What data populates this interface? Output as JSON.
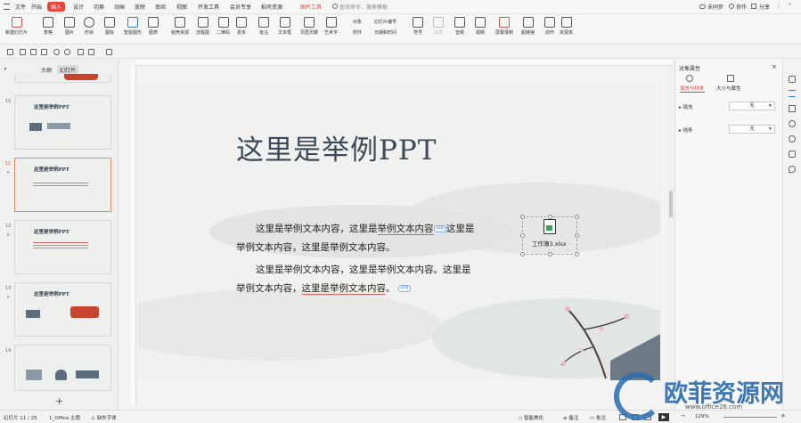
{
  "menubar": {
    "file": "文件",
    "items": [
      "开始",
      "插入",
      "设计",
      "切换",
      "动画",
      "放映",
      "审阅",
      "视图",
      "开发工具",
      "会员专享",
      "稻壳资源"
    ],
    "active": "插入",
    "picture_tool": "图片工具",
    "search": "查找命令、搜索模板",
    "unsync": "未同步",
    "collab": "协作",
    "share": "分享"
  },
  "ribbon": {
    "items": [
      "新建幻灯片",
      "表格",
      "图片",
      "形状",
      "图标",
      "智能图形",
      "图表",
      "稻壳资源",
      "流程图",
      "二维码",
      "更多",
      "批注",
      "文本框",
      "页眉页脚",
      "艺术字",
      "符号",
      "公式",
      "音频",
      "视频",
      "屏幕录制",
      "超链接",
      "动作",
      "资源夹"
    ],
    "small": [
      "对象",
      "幻灯片编号",
      "附件",
      "日期和时间"
    ]
  },
  "leftpane": {
    "tab_outline": "大纲",
    "tab_slides": "幻灯片",
    "thumbs": [
      {
        "num": "10",
        "title": "这里是举例PPT"
      },
      {
        "num": "11",
        "title": "这里是举例PPT"
      },
      {
        "num": "12",
        "title": "这里是举例PPT"
      },
      {
        "num": "13",
        "title": "这里是举例PPT"
      },
      {
        "num": "14",
        "title": ""
      }
    ],
    "add": "+"
  },
  "slide": {
    "title": "这里是举例PPT",
    "para1_line1_a": "这里是举例文本内容，这里是",
    "para1_line1_u": "举例文本内容",
    "para1_line1_b": "这里是",
    "para1_line2": "举例文本内容，这里是举例文本内容。",
    "para2_line1": "这里是举例文本内容，这里是举例文本内容。这里是",
    "para2_line2_a": "举例文本内容，",
    "para2_line2_u": "这里是举例文本内容",
    "para2_line2_b": "。",
    "badge": "x16",
    "file_caption": "工作簿3.xlsx",
    "watermark": "欧菲资源网",
    "watermark_url": "www.office26.com"
  },
  "rightpane": {
    "title": "对象属性",
    "tab_fill": "填充与线条",
    "tab_size": "大小与属性",
    "fill_label": "填充",
    "fill_value": "无",
    "line_label": "线条",
    "line_value": "无"
  },
  "statusbar": {
    "slide_info": "幻灯片 11 / 25",
    "theme": "1_Office 主题",
    "font_missing": "缺失字体",
    "beautify": "智能美化",
    "notes": "备注",
    "comment": "批注",
    "zoom": "129%"
  },
  "colors": {
    "accent": "#e8453c",
    "title": "#3c4a58",
    "watermark_blue": "#2b6cb0"
  }
}
